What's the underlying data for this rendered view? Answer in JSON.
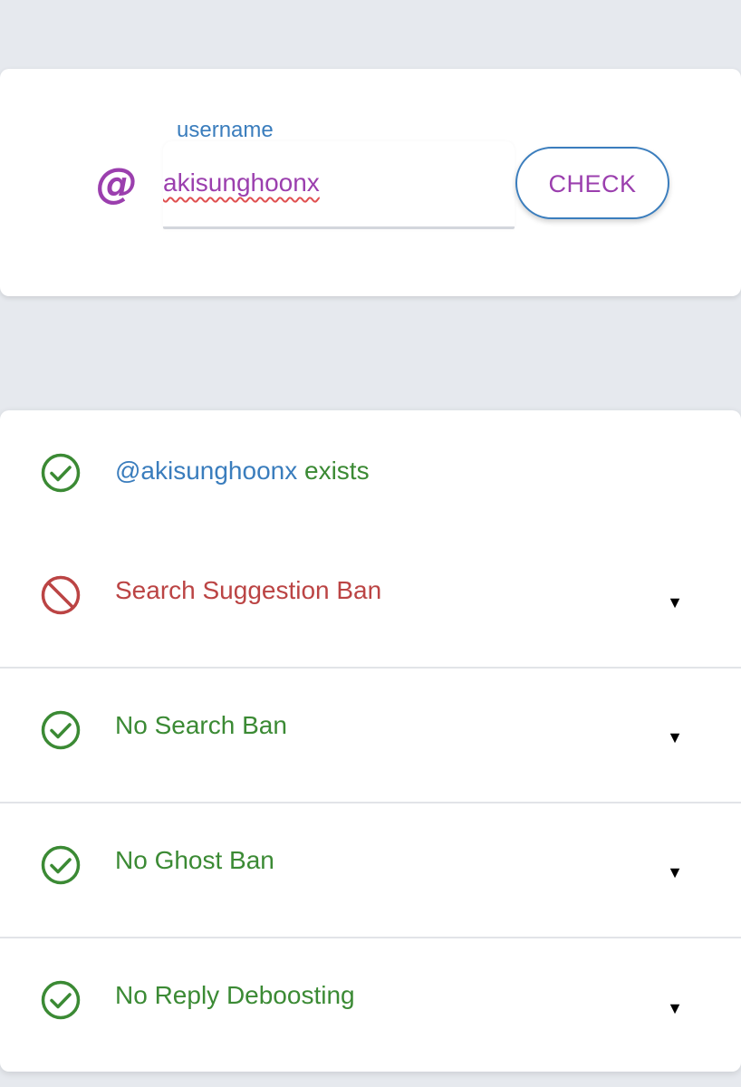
{
  "search": {
    "at_symbol": "@",
    "label": "username",
    "value": "akisunghoonx",
    "button_label": "CHECK"
  },
  "results": {
    "exists": {
      "username_link": "@akisunghoonx",
      "suffix": " exists",
      "status": "ok",
      "icon": "check-circle-icon"
    },
    "items": [
      {
        "label": "Search Suggestion Ban",
        "status": "banned",
        "icon": "prohibited-icon",
        "toggle": "▼"
      },
      {
        "label": "No Search Ban",
        "status": "ok",
        "icon": "check-circle-icon",
        "toggle": "▼"
      },
      {
        "label": "No Ghost Ban",
        "status": "ok",
        "icon": "check-circle-icon",
        "toggle": "▼"
      },
      {
        "label": "No Reply Deboosting",
        "status": "ok",
        "icon": "check-circle-icon",
        "toggle": "▼"
      }
    ]
  },
  "colors": {
    "background": "#e6e9ee",
    "accent_purple": "#9b3fae",
    "accent_blue": "#3a7dbd",
    "ok_green": "#3b8a34",
    "ban_red": "#bb4444"
  }
}
